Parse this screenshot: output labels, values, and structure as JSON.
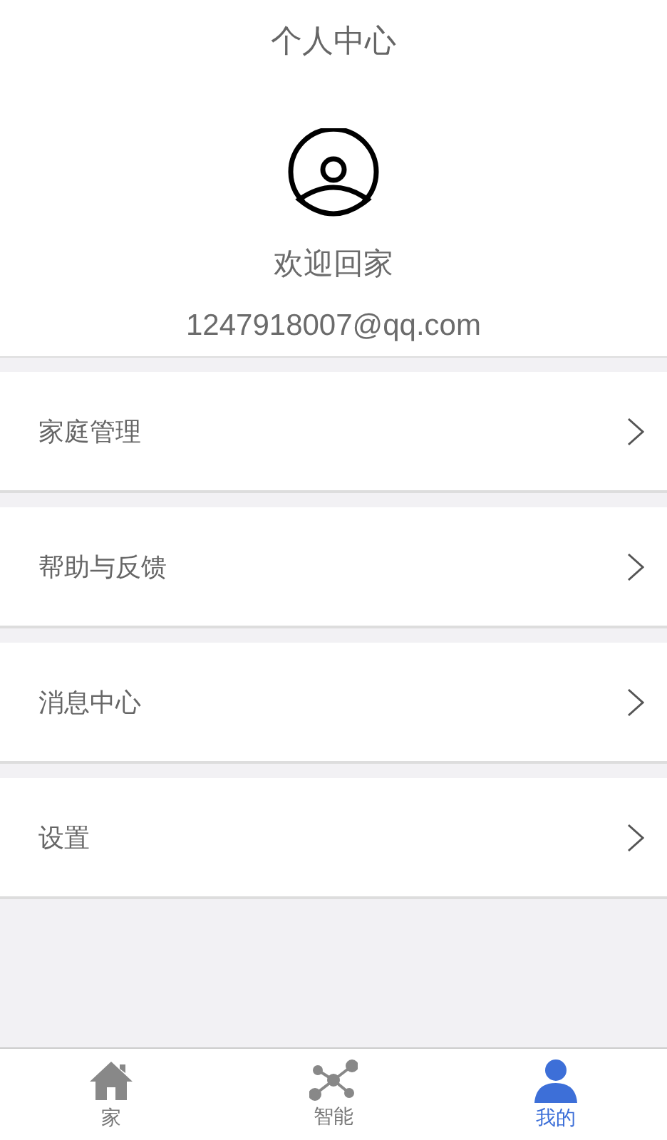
{
  "header": {
    "title": "个人中心"
  },
  "profile": {
    "greeting": "欢迎回家",
    "email": "1247918007@qq.com"
  },
  "menu": [
    {
      "label": "家庭管理"
    },
    {
      "label": "帮助与反馈"
    },
    {
      "label": "消息中心"
    },
    {
      "label": "设置"
    }
  ],
  "tab_bar": [
    {
      "kind": "home",
      "label": "家",
      "selected": false
    },
    {
      "kind": "network",
      "label": "智能",
      "selected": false
    },
    {
      "kind": "person",
      "label": "我的",
      "selected": true
    }
  ]
}
